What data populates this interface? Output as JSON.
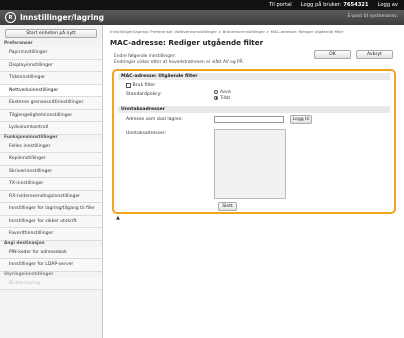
{
  "topbar": {
    "portal": "Til portal",
    "login_label": "Logg på bruker:",
    "user_id": "7654321",
    "logout": "Logg av"
  },
  "header": {
    "logo_text": "R",
    "title": "Innstillinger/lagring",
    "right_text": "E-post til systemansv."
  },
  "sidebar": {
    "start_button": "Start enheten på nytt",
    "groups": [
      {
        "header": "Preferanser",
        "items": [
          "Papirinnstillinger",
          "Displayinnstillinger",
          "Tidsinnstillinger",
          "Nettverksinnstillinger",
          "Eksterne grensesnittinnstillinger",
          "Tilgjengelighetsinnstillinger",
          "Lydvolumkontroll"
        ]
      },
      {
        "header": "Funksjonsinnstillinger",
        "items": [
          "Felles innstillinger",
          "Kopiinnstillinger",
          "Skriverinnstillinger",
          "TX-innstillinger",
          "RX-/videresendingsinnstillinger",
          "Innstillinger for lagring/tilgang til filer",
          "Innstillinger for sikker utskrift",
          "Favorittinnstillinger"
        ]
      },
      {
        "header": "Angi destinasjon",
        "items": [
          "PIN-koder for adressebok",
          "Innstillinger for LDAP-server"
        ]
      },
      {
        "header": "Styringsinnstillinger",
        "items": [
          "Brukerstyring"
        ]
      }
    ]
  },
  "main": {
    "breadcrumb": "Innstillinger/lagring: Preferanser: Nettverksinnstillinger > Brannmurinnstillinger > MAC-adresse: Rediger utgående filter",
    "title": "MAC-adresse: Rediger utgående filter",
    "ok": "OK",
    "cancel": "Avbryt",
    "info1": "Endre følgende innstillinger:",
    "info2": "Endringer virker etter at hovedstrømmen er slått AV og PÅ.",
    "section1": "MAC-adresse: Utgående filter",
    "use_filter": "Bruk filter",
    "default_policy": "Standardpolicy:",
    "reject": "Avvis",
    "allow": "Tillat",
    "section2": "Unntaksadresser",
    "address_label": "Adresse som skal lagres:",
    "add_button": "Legg til",
    "exceptions_label": "Unntaksadresser:",
    "delete_button": "Slett",
    "up_arrow": "▲"
  }
}
